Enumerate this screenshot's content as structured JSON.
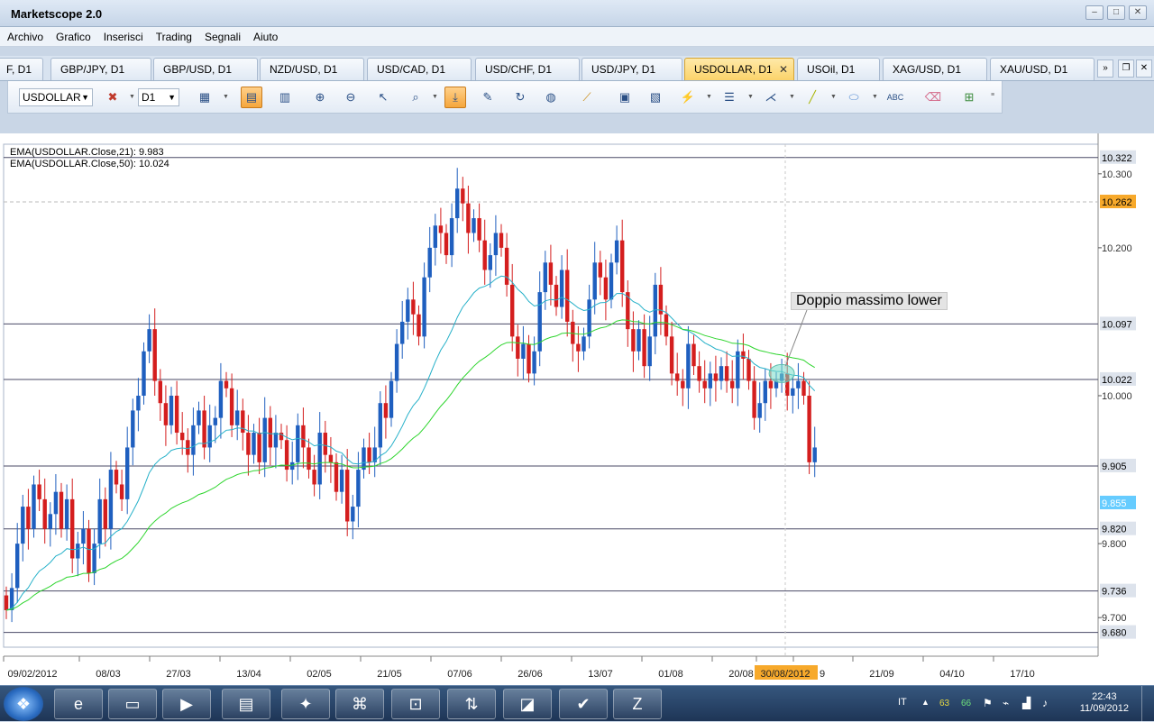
{
  "window": {
    "title": "Marketscope 2.0",
    "controls": [
      "–",
      "□",
      "✕"
    ]
  },
  "menu": [
    "Archivo",
    "Grafico",
    "Inserisci",
    "Trading",
    "Segnali",
    "Aiuto"
  ],
  "tabs": [
    {
      "label": "F, D1",
      "active": false
    },
    {
      "label": "GBP/JPY, D1",
      "active": false
    },
    {
      "label": "GBP/USD, D1",
      "active": false
    },
    {
      "label": "NZD/USD, D1",
      "active": false
    },
    {
      "label": "USD/CAD, D1",
      "active": false
    },
    {
      "label": "USD/CHF, D1",
      "active": false
    },
    {
      "label": "USD/JPY, D1",
      "active": false
    },
    {
      "label": "USDOLLAR, D1",
      "active": true
    },
    {
      "label": "USOil, D1",
      "active": false
    },
    {
      "label": "XAG/USD, D1",
      "active": false
    },
    {
      "label": "XAU/USD, D1",
      "active": false
    }
  ],
  "toolbar": {
    "instrument": "USDOLLAR",
    "timeframe": "D1"
  },
  "indicators": [
    {
      "label": "EMA(USDOLLAR.Close,21): 9.983",
      "color": "#27b1c9"
    },
    {
      "label": "EMA(USDOLLAR.Close,50): 10.024",
      "color": "#2ed52e"
    }
  ],
  "annotation": "Doppio massimo lower",
  "chart_data": {
    "type": "candlestick",
    "instrument": "USDOLLAR",
    "timeframe": "D1",
    "ylim": [
      9.66,
      10.34
    ],
    "y_ticks": [
      "10.300",
      "10.200",
      "10.000",
      "9.800",
      "9.700"
    ],
    "horizontal_levels": [
      10.322,
      10.097,
      10.022,
      9.905,
      9.82,
      9.736,
      9.68
    ],
    "dashed_levels": [
      10.262
    ],
    "price_labels": [
      {
        "value": "10.322",
        "style": "level"
      },
      {
        "value": "10.262",
        "style": "highlight"
      },
      {
        "value": "10.097",
        "style": "level"
      },
      {
        "value": "10.022",
        "style": "level"
      },
      {
        "value": "9.905",
        "style": "level"
      },
      {
        "value": "9.855",
        "style": "current"
      },
      {
        "value": "9.820",
        "style": "level"
      },
      {
        "value": "9.736",
        "style": "level"
      },
      {
        "value": "9.680",
        "style": "level"
      }
    ],
    "x_labels": [
      "09/02/2012",
      "08/03",
      "27/03",
      "13/04",
      "02/05",
      "21/05",
      "07/06",
      "26/06",
      "13/07",
      "01/08",
      "20/08",
      "30/08/2012",
      "9",
      "21/09",
      "04/10",
      "17/10"
    ],
    "cursor_date": "30/08/2012",
    "up_color": "#1f5fbf",
    "down_color": "#d41e1e",
    "closes": [
      9.71,
      9.74,
      9.8,
      9.85,
      9.82,
      9.88,
      9.86,
      9.82,
      9.84,
      9.87,
      9.82,
      9.86,
      9.78,
      9.8,
      9.82,
      9.76,
      9.8,
      9.86,
      9.82,
      9.9,
      9.88,
      9.86,
      9.93,
      9.98,
      10.0,
      10.06,
      10.09,
      10.02,
      9.99,
      9.96,
      10.0,
      9.95,
      9.94,
      9.92,
      9.96,
      9.98,
      9.93,
      9.96,
      9.97,
      10.02,
      10.01,
      9.96,
      9.98,
      9.95,
      9.92,
      9.95,
      9.91,
      9.97,
      9.93,
      9.95,
      9.94,
      9.9,
      9.91,
      9.96,
      9.93,
      9.9,
      9.88,
      9.95,
      9.92,
      9.91,
      9.87,
      9.9,
      9.83,
      9.85,
      9.9,
      9.93,
      9.91,
      9.93,
      9.99,
      9.97,
      10.02,
      10.07,
      10.1,
      10.13,
      10.11,
      10.08,
      10.16,
      10.2,
      10.23,
      10.22,
      10.19,
      10.24,
      10.28,
      10.26,
      10.22,
      10.24,
      10.21,
      10.17,
      10.19,
      10.22,
      10.2,
      10.15,
      10.08,
      10.05,
      10.07,
      10.03,
      10.06,
      10.14,
      10.18,
      10.15,
      10.12,
      10.17,
      10.1,
      10.07,
      10.06,
      10.08,
      10.13,
      10.18,
      10.16,
      10.13,
      10.18,
      10.21,
      10.14,
      10.09,
      10.06,
      10.09,
      10.04,
      10.08,
      10.15,
      10.11,
      10.08,
      10.03,
      10.02,
      10.01,
      10.07,
      10.04,
      10.02,
      10.01,
      10.03,
      10.02,
      10.04,
      10.02,
      10.01,
      10.06,
      10.05,
      10.02,
      9.97,
      9.99,
      10.02,
      10.01,
      10.02,
      10.03,
      10.0,
      10.01,
      10.02,
      10.0,
      9.91,
      9.93
    ]
  },
  "taskbar": {
    "start_icon": "windows-logo-icon",
    "apps": [
      "internet-explorer-icon",
      "file-explorer-icon",
      "media-player-icon",
      "marketscope-icon",
      "language-bar-icon",
      "pdf-reader-icon",
      "lock-folder-icon",
      "sync-icon",
      "sticky-notes-icon",
      "checkmark-app-icon",
      "zoom-app-icon"
    ],
    "tray": {
      "language": "IT",
      "badge1": "63",
      "badge2": "66",
      "time": "22:43",
      "date": "11/09/2012"
    }
  }
}
